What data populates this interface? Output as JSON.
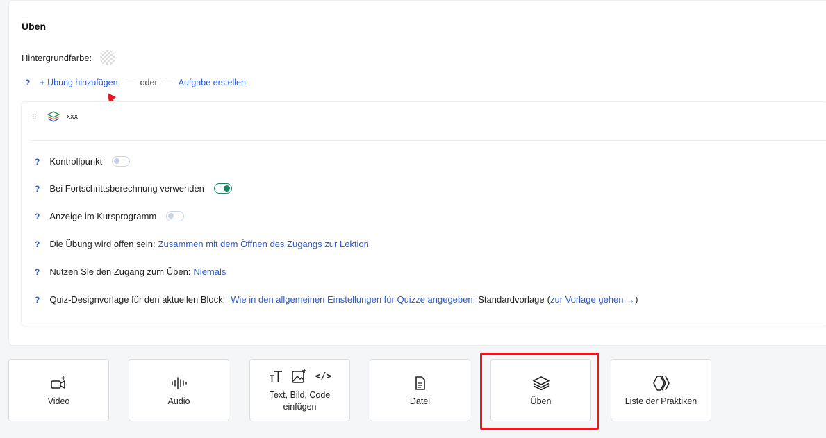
{
  "section": {
    "title": "Üben",
    "background_label": "Hintergrundfarbe:"
  },
  "add_row": {
    "help": "?",
    "add_exercise": "+ Übung hinzufügen",
    "or": "oder",
    "create_task": "Aufgabe erstellen"
  },
  "item": {
    "name": "xxx",
    "icon": "layers-icon"
  },
  "settings": [
    {
      "help": "?",
      "label": "Kontrollpunkt",
      "toggle": false
    },
    {
      "help": "?",
      "label": "Bei Fortschrittsberechnung verwenden",
      "toggle": true
    },
    {
      "help": "?",
      "label": "Anzeige im Kursprogramm",
      "toggle": false
    },
    {
      "help": "?",
      "label": "Die Übung wird offen sein:",
      "link": "Zusammen mit dem Öffnen des Zugangs zur Lektion"
    },
    {
      "help": "?",
      "label": "Nutzen Sie den Zugang zum Üben:",
      "link": "Niemals"
    },
    {
      "help": "?",
      "label": "Quiz-Designvorlage für den aktuellen Block:",
      "link": "Wie in den allgemeinen Einstellungen für Quizze angegeben:",
      "value": "Standardvorlage",
      "open_paren": "(",
      "link2": "zur Vorlage gehen →",
      "close_paren": ")"
    }
  ],
  "tiles": [
    {
      "label": "Video",
      "icon": "video-plus-icon"
    },
    {
      "label": "Audio",
      "icon": "audio-wave-icon"
    },
    {
      "label": "Text, Bild, Code einfügen",
      "icons": [
        "text-size-icon",
        "image-plus-icon",
        "code-icon"
      ],
      "code_glyph": "</>"
    },
    {
      "label": "Datei",
      "icon": "file-icon"
    },
    {
      "label": "Üben",
      "icon": "layers-icon"
    },
    {
      "label": "Liste der Praktiken",
      "icon": "chevrons-icon"
    }
  ],
  "colors": {
    "link": "#2b5bd7",
    "toggle_on": "#17845f",
    "highlight": "#e5191f"
  }
}
